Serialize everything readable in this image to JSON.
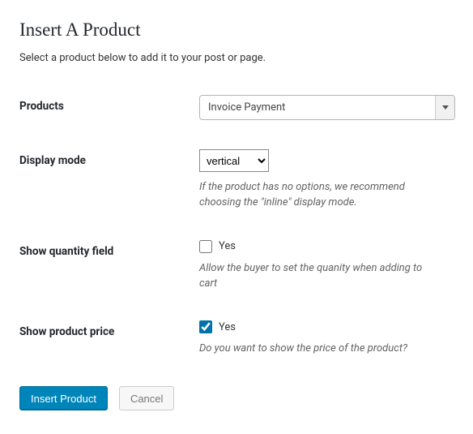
{
  "header": {
    "title": "Insert A Product",
    "intro": "Select a product below to add it to your post or page."
  },
  "fields": {
    "products": {
      "label": "Products",
      "value": "Invoice Payment"
    },
    "display_mode": {
      "label": "Display mode",
      "value": "vertical",
      "hint": "If the product has no options, we recommend choosing the \"inline\" display mode."
    },
    "show_quantity": {
      "label": "Show quantity field",
      "checkbox_label": "Yes",
      "checked": false,
      "hint": "Allow the buyer to set the quanity when adding to cart"
    },
    "show_price": {
      "label": "Show product price",
      "checkbox_label": "Yes",
      "checked": true,
      "hint": "Do you want to show the price of the product?"
    }
  },
  "actions": {
    "insert": "Insert Product",
    "cancel": "Cancel"
  }
}
